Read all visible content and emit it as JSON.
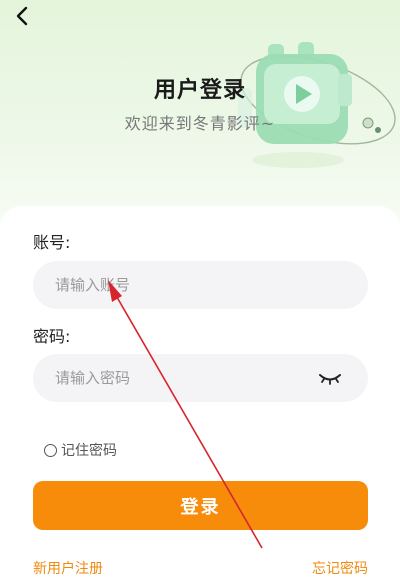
{
  "header": {
    "back_icon": "chevron-left-icon",
    "title": "用户登录",
    "subtitle": "欢迎来到冬青影评~"
  },
  "form": {
    "account_label": "账号:",
    "account_placeholder": "请输入账号",
    "password_label": "密码:",
    "password_placeholder": "请输入密码",
    "password_toggle_icon": "eye-closed-icon",
    "remember_label": "记住密码",
    "remember_checked": false,
    "login_button": "登录"
  },
  "footer": {
    "register_link": "新用户注册",
    "forgot_link": "忘记密码"
  },
  "colors": {
    "accent": "#f78c0b",
    "link": "#f08a0e",
    "input_bg": "#f4f4f6",
    "annotation_arrow": "#d6262c"
  }
}
